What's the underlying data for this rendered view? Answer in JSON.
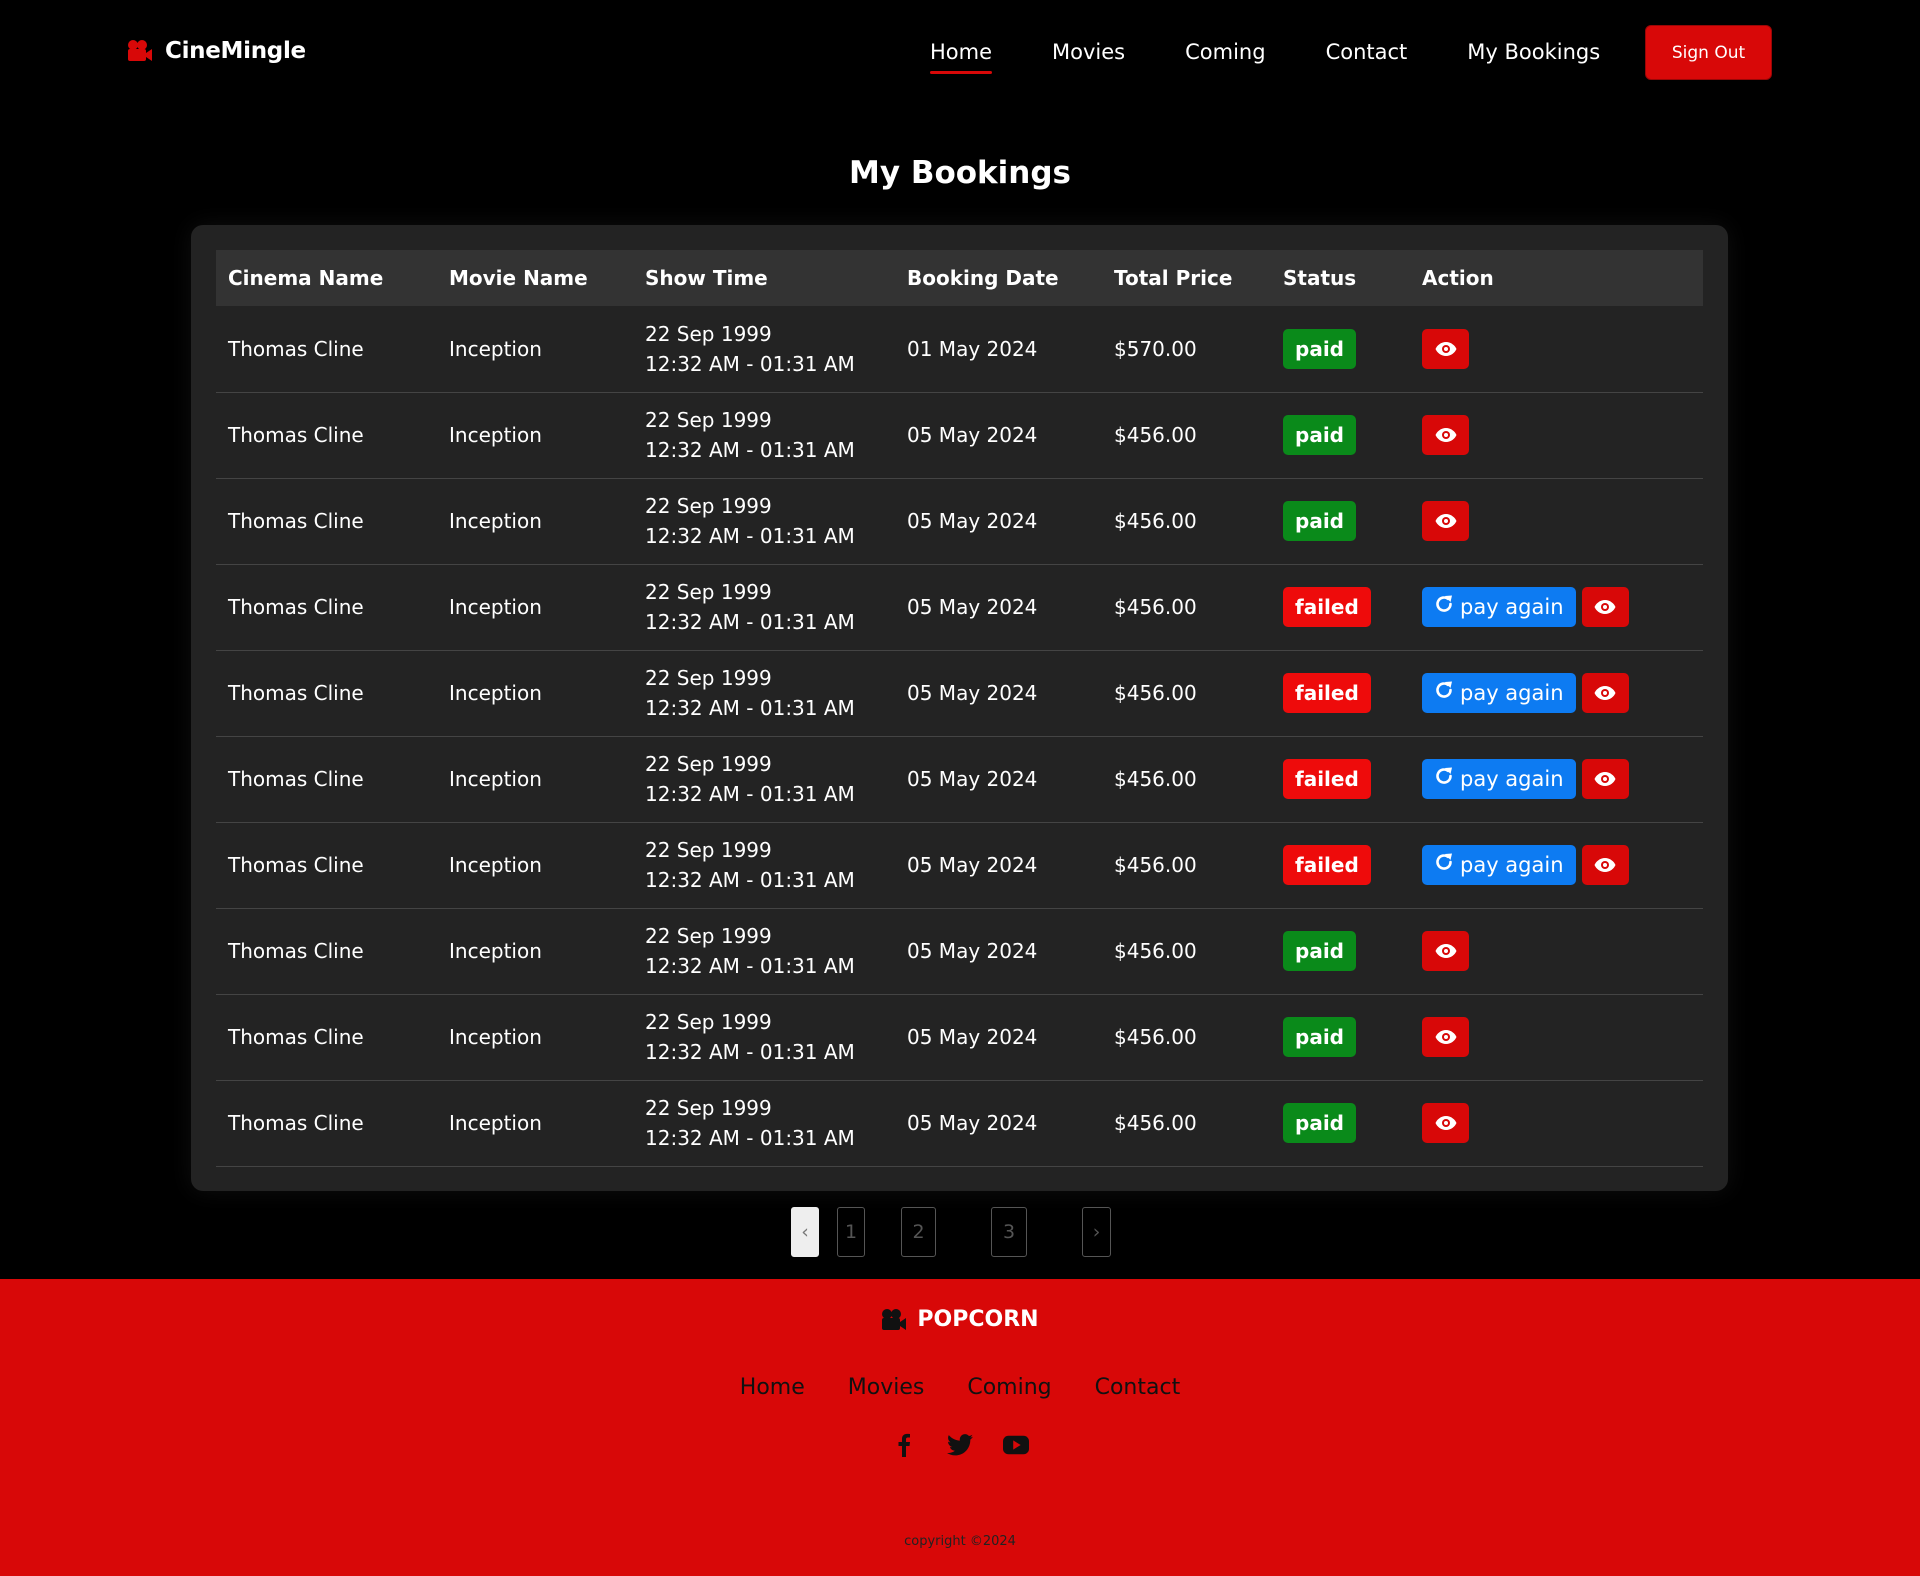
{
  "header": {
    "brand": "CineMingle",
    "nav": [
      {
        "label": "Home",
        "active": true
      },
      {
        "label": "Movies",
        "active": false
      },
      {
        "label": "Coming",
        "active": false
      },
      {
        "label": "Contact",
        "active": false
      },
      {
        "label": "My Bookings",
        "active": false
      }
    ],
    "signout_label": "Sign Out"
  },
  "page_title": "My Bookings",
  "table": {
    "headers": [
      "Cinema Name",
      "Movie Name",
      "Show Time",
      "Booking Date",
      "Total Price",
      "Status",
      "Action"
    ],
    "rows": [
      {
        "cinema": "Thomas Cline",
        "movie": "Inception",
        "show_date": "22 Sep 1999",
        "show_time": "12:32 AM - 01:31 AM",
        "booking_date": "01 May 2024",
        "price": "$570.00",
        "status": "paid"
      },
      {
        "cinema": "Thomas Cline",
        "movie": "Inception",
        "show_date": "22 Sep 1999",
        "show_time": "12:32 AM - 01:31 AM",
        "booking_date": "05 May 2024",
        "price": "$456.00",
        "status": "paid"
      },
      {
        "cinema": "Thomas Cline",
        "movie": "Inception",
        "show_date": "22 Sep 1999",
        "show_time": "12:32 AM - 01:31 AM",
        "booking_date": "05 May 2024",
        "price": "$456.00",
        "status": "paid"
      },
      {
        "cinema": "Thomas Cline",
        "movie": "Inception",
        "show_date": "22 Sep 1999",
        "show_time": "12:32 AM - 01:31 AM",
        "booking_date": "05 May 2024",
        "price": "$456.00",
        "status": "failed"
      },
      {
        "cinema": "Thomas Cline",
        "movie": "Inception",
        "show_date": "22 Sep 1999",
        "show_time": "12:32 AM - 01:31 AM",
        "booking_date": "05 May 2024",
        "price": "$456.00",
        "status": "failed"
      },
      {
        "cinema": "Thomas Cline",
        "movie": "Inception",
        "show_date": "22 Sep 1999",
        "show_time": "12:32 AM - 01:31 AM",
        "booking_date": "05 May 2024",
        "price": "$456.00",
        "status": "failed"
      },
      {
        "cinema": "Thomas Cline",
        "movie": "Inception",
        "show_date": "22 Sep 1999",
        "show_time": "12:32 AM - 01:31 AM",
        "booking_date": "05 May 2024",
        "price": "$456.00",
        "status": "failed"
      },
      {
        "cinema": "Thomas Cline",
        "movie": "Inception",
        "show_date": "22 Sep 1999",
        "show_time": "12:32 AM - 01:31 AM",
        "booking_date": "05 May 2024",
        "price": "$456.00",
        "status": "paid"
      },
      {
        "cinema": "Thomas Cline",
        "movie": "Inception",
        "show_date": "22 Sep 1999",
        "show_time": "12:32 AM - 01:31 AM",
        "booking_date": "05 May 2024",
        "price": "$456.00",
        "status": "paid"
      },
      {
        "cinema": "Thomas Cline",
        "movie": "Inception",
        "show_date": "22 Sep 1999",
        "show_time": "12:32 AM - 01:31 AM",
        "booking_date": "05 May 2024",
        "price": "$456.00",
        "status": "paid"
      }
    ],
    "pay_again_label": "pay again",
    "icons": {
      "view": "eye-icon",
      "retry": "refresh-icon"
    }
  },
  "pagination": {
    "prev": "‹",
    "pages": [
      "1",
      "2",
      "3"
    ],
    "next": "›"
  },
  "footer": {
    "brand": "POPCORN",
    "links": [
      "Home",
      "Movies",
      "Coming",
      "Contact"
    ],
    "social": [
      "facebook-icon",
      "twitter-icon",
      "youtube-icon"
    ],
    "copyright": "copyright ©2024"
  },
  "colors": {
    "accent_red": "#d80808",
    "paid_green": "#0a8a1a",
    "failed_red": "#ee0b0b",
    "pay_blue": "#0d7bf2",
    "card_bg": "#232323"
  }
}
